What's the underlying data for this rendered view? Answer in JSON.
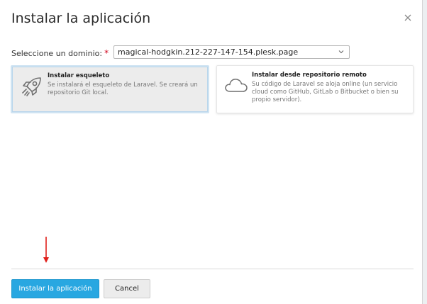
{
  "dialog": {
    "title": "Instalar la aplicación"
  },
  "domain": {
    "label": "Seleccione un dominio:",
    "required_mark": "*",
    "selected_value": "magical-hodgkin.212-227-147-154.plesk.page"
  },
  "options": [
    {
      "title": "Instalar esqueleto",
      "description": "Se instalará el esqueleto de Laravel. Se creará un repositorio Git local.",
      "icon": "rocket-icon",
      "selected": true
    },
    {
      "title": "Instalar desde repositorio remoto",
      "description": "Su código de Laravel se aloja online (un servicio cloud como GitHub, GitLab o Bitbucket o bien su propio servidor).",
      "icon": "cloud-icon",
      "selected": false
    }
  ],
  "buttons": {
    "install_label": "Instalar la aplicación",
    "cancel_label": "Cancel"
  },
  "colors": {
    "primary": "#28a7e1",
    "required": "#d0021b",
    "annotation_arrow": "#e0201b"
  }
}
